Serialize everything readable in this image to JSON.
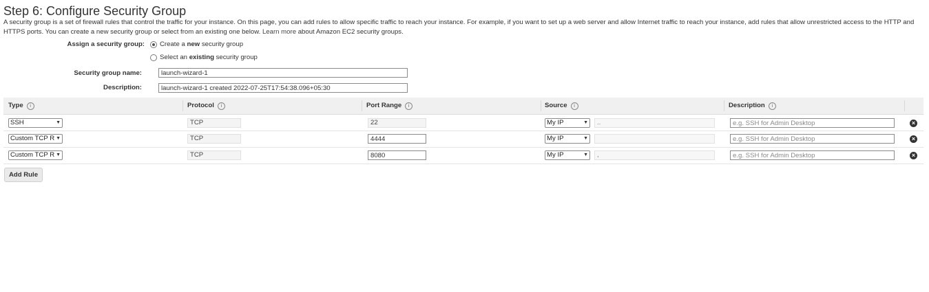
{
  "page": {
    "title": "Step 6: Configure Security Group",
    "intro_text": "A security group is a set of firewall rules that control the traffic for your instance. On this page, you can add rules to allow specific traffic to reach your instance. For example, if you want to set up a web server and allow Internet traffic to reach your instance, add rules that allow unrestricted access to the HTTP and HTTPS ports. You can create a new security group or select from an existing one below.",
    "learn_more": "Learn more",
    "intro_suffix": "about Amazon EC2 security groups."
  },
  "assign": {
    "label": "Assign a security group:",
    "option_new_prefix": "Create a",
    "option_new_bold": "new",
    "option_new_suffix": "security group",
    "option_existing_prefix": "Select an",
    "option_existing_bold": "existing",
    "option_existing_suffix": "security group",
    "selected": "new"
  },
  "group_name": {
    "label": "Security group name:",
    "value": "launch-wizard-1"
  },
  "group_description": {
    "label": "Description:",
    "value": "launch-wizard-1 created 2022-07-25T17:54:38.096+05:30"
  },
  "table": {
    "headers": {
      "type": "Type",
      "protocol": "Protocol",
      "port_range": "Port Range",
      "source": "Source",
      "description": "Description"
    },
    "info_glyph": "i",
    "delete_glyph": "×",
    "rows": [
      {
        "type": "SSH",
        "protocol": "TCP",
        "port": "22",
        "source": "My IP",
        "source_value": "..",
        "description_placeholder": "e.g. SSH for Admin Desktop"
      },
      {
        "type": "Custom TCP R",
        "protocol": "TCP",
        "port": "4444",
        "source": "My IP",
        "source_value": "",
        "description_placeholder": "e.g. SSH for Admin Desktop"
      },
      {
        "type": "Custom TCP R",
        "protocol": "TCP",
        "port": "8080",
        "source": "My IP",
        "source_value": ",",
        "description_placeholder": "e.g. SSH for Admin Desktop"
      }
    ]
  },
  "add_rule_button": "Add Rule"
}
